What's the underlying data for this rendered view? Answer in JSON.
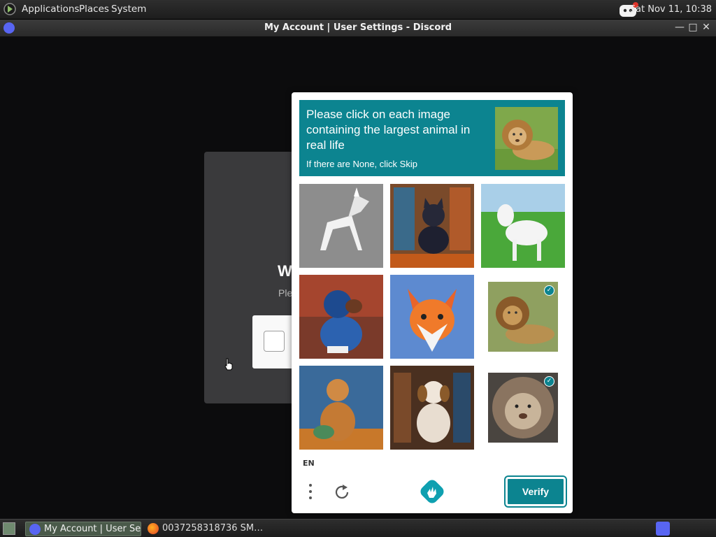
{
  "top_panel": {
    "menus": [
      "Applications",
      "Places",
      "System"
    ],
    "clock": "Sat Nov 11, 10:38"
  },
  "window": {
    "title": "My Account | User Settings - Discord",
    "controls": {
      "minimize": "—",
      "maximize": "□",
      "close": "✕"
    }
  },
  "modal": {
    "heading": "W",
    "subtitle": "Ple"
  },
  "captcha": {
    "prompt": "Please click on each image containing the largest animal in real life",
    "hint": "If there are None, click Skip",
    "language": "EN",
    "verify_label": "Verify",
    "tiles": [
      {
        "subject": "white paper animal",
        "selected": false
      },
      {
        "subject": "dog in library",
        "selected": false
      },
      {
        "subject": "white goat on grass",
        "selected": false
      },
      {
        "subject": "blue dog in library",
        "selected": false
      },
      {
        "subject": "painted fox",
        "selected": false
      },
      {
        "subject": "lion lying",
        "selected": true
      },
      {
        "subject": "dog with books",
        "selected": false
      },
      {
        "subject": "puppy in library",
        "selected": false
      },
      {
        "subject": "lion face",
        "selected": true
      }
    ],
    "accent_color": "#0c8490"
  },
  "taskbar": {
    "tasks": [
      {
        "label": "My Account | User Se…",
        "icon": "discord-icon"
      },
      {
        "label": "0037258318736 SM…",
        "icon": "firefox-icon"
      }
    ]
  }
}
